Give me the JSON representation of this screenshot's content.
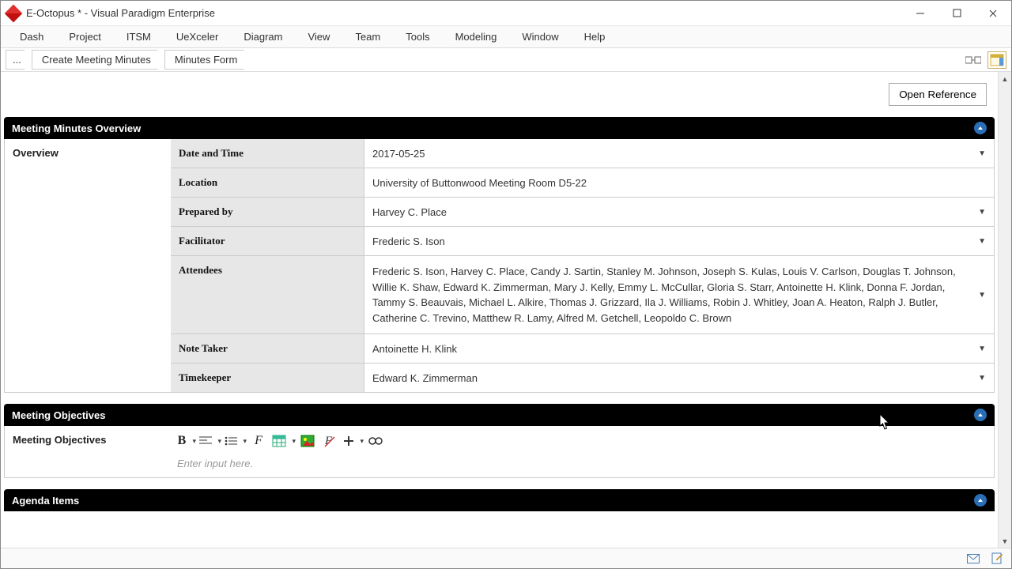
{
  "window": {
    "title": "E-Octopus * - Visual Paradigm Enterprise"
  },
  "menu": {
    "items": [
      "Dash",
      "Project",
      "ITSM",
      "UeXceler",
      "Diagram",
      "View",
      "Team",
      "Tools",
      "Modeling",
      "Window",
      "Help"
    ]
  },
  "breadcrumb": {
    "first": "...",
    "items": [
      "Create Meeting Minutes",
      "Minutes Form"
    ]
  },
  "buttons": {
    "open_reference": "Open Reference"
  },
  "sections": {
    "overview_header": "Meeting Minutes Overview",
    "objectives_header": "Meeting Objectives",
    "agenda_header": "Agenda Items"
  },
  "overview": {
    "left_label": "Overview",
    "rows": [
      {
        "label": "Date and Time",
        "value": "2017-05-25",
        "dropdown": true
      },
      {
        "label": "Location",
        "value": "University of Buttonwood Meeting Room D5-22",
        "dropdown": false
      },
      {
        "label": "Prepared by",
        "value": "Harvey C. Place",
        "dropdown": true
      },
      {
        "label": "Facilitator",
        "value": "Frederic S. Ison",
        "dropdown": true
      },
      {
        "label": "Attendees",
        "value": "Frederic S. Ison, Harvey C. Place, Candy J. Sartin, Stanley M. Johnson, Joseph S. Kulas, Louis V. Carlson, Douglas T. Johnson, Willie K. Shaw, Edward K. Zimmerman, Mary J. Kelly, Emmy L. McCullar, Gloria S. Starr, Antoinette H. Klink, Donna F. Jordan, Tammy S. Beauvais, Michael L. Alkire, Thomas J. Grizzard, Ila J. Williams, Robin J. Whitley, Joan A. Heaton, Ralph J. Butler, Catherine C. Trevino, Matthew R. Lamy, Alfred M. Getchell, Leopoldo C. Brown",
        "dropdown": true,
        "multi": true
      },
      {
        "label": "Note Taker",
        "value": "Antoinette H. Klink",
        "dropdown": true
      },
      {
        "label": "Timekeeper",
        "value": "Edward K. Zimmerman",
        "dropdown": true
      }
    ]
  },
  "objectives": {
    "left_label": "Meeting Objectives",
    "placeholder": "Enter input here."
  }
}
